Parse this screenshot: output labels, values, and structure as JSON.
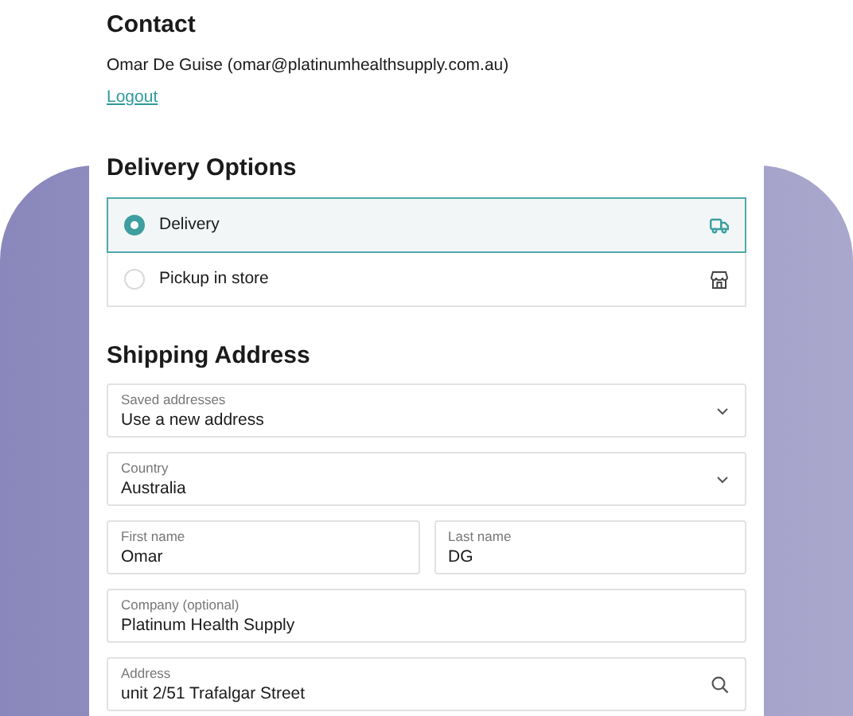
{
  "contact": {
    "title": "Contact",
    "details": "Omar De Guise (omar@platinumhealthsupply.com.au)",
    "logout": "Logout"
  },
  "delivery_options": {
    "title": "Delivery Options",
    "options": [
      {
        "label": "Delivery",
        "selected": true,
        "kind": "truck"
      },
      {
        "label": "Pickup in store",
        "selected": false,
        "kind": "store"
      }
    ]
  },
  "shipping_address": {
    "title": "Shipping Address",
    "rows": [
      [
        {
          "label": "Saved addresses",
          "value": "Use a new address",
          "kind": "select"
        }
      ],
      [
        {
          "label": "Country",
          "value": "Australia",
          "kind": "select"
        }
      ],
      [
        {
          "label": "First name",
          "value": "Omar",
          "kind": "text"
        },
        {
          "label": "Last name",
          "value": "DG",
          "kind": "text"
        }
      ],
      [
        {
          "label": "Company (optional)",
          "value": "Platinum Health Supply",
          "kind": "text"
        }
      ],
      [
        {
          "label": "Address",
          "value": "unit 2/51 Trafalgar Street",
          "kind": "search"
        }
      ]
    ]
  }
}
